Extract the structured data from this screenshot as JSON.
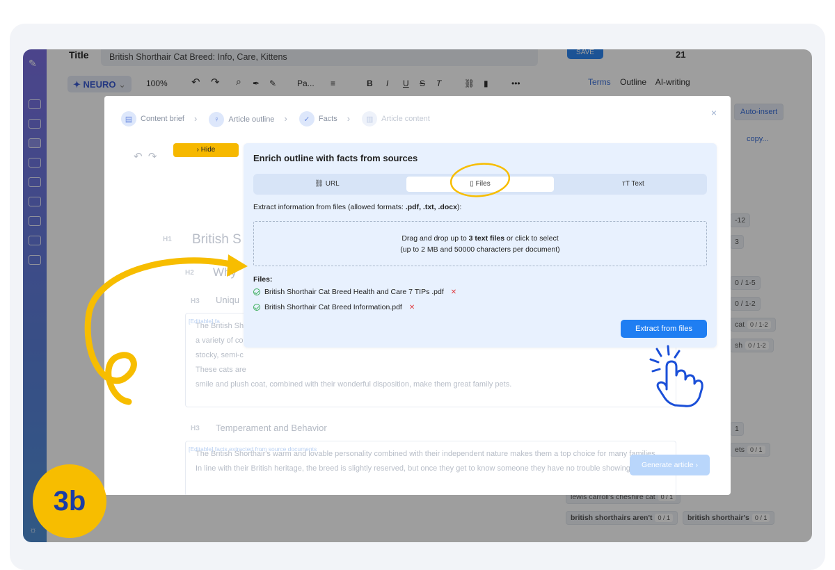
{
  "app": {
    "title_label": "Title",
    "title_value": "British Shorthair Cat Breed: Info, Care, Kittens",
    "save_label": "SAVE",
    "score": "21",
    "neuro_label": "NEURO",
    "zoom": "100%",
    "style_select": "Pa...",
    "right_tabs": [
      "Terms",
      "Outline",
      "AI-writing"
    ],
    "auto_insert": "Auto-insert",
    "copy_label": "copy..."
  },
  "background_chips": [
    {
      "label": "-12"
    },
    {
      "label": "3"
    },
    {
      "label": "0 / 1-5"
    },
    {
      "label": "0 / 1-2"
    },
    {
      "label": "cat",
      "count": "0 / 1-2"
    },
    {
      "label": "sh",
      "count": "0 / 1-2"
    },
    {
      "label": "1"
    },
    {
      "label": "ets",
      "count": "0 / 1"
    },
    {
      "label": "lewis carroll's cheshire cat",
      "count": "0 / 1"
    },
    {
      "label": "british shorthairs aren't",
      "count": "0 / 1"
    },
    {
      "label": "british shorthair's",
      "count": "0 / 1"
    }
  ],
  "modal": {
    "steps": [
      {
        "label": "Content brief"
      },
      {
        "label": "Article outline"
      },
      {
        "label": "Facts"
      },
      {
        "label": "Article content"
      }
    ],
    "hide_label": "› Hide",
    "h1_label": "H1",
    "h1_text": "British S",
    "h2_label": "H2",
    "h2_text": "Why",
    "h3_label": "H3",
    "h3_text_1": "Uniqu",
    "editable_tag": "[Editable] facts extracted from source documents",
    "editable_tag_short": "[Editable] fa",
    "para1": [
      "The British Sh",
      "a variety of co",
      "stocky, semi-c",
      "These cats are",
      "smile and plush coat, combined with their wonderful disposition, make them great family pets."
    ],
    "h3_text_2": "Temperament and Behavior",
    "para2": [
      "The British Shorthair's warm and lovable personality combined with their independent nature makes them a top choice for many families.",
      "In line with their British heritage, the breed is slightly reserved, but once they get to know someone they have no trouble showing"
    ],
    "generate_label": "Generate article ›"
  },
  "panel": {
    "title": "Enrich outline with facts from sources",
    "tabs": [
      {
        "label": "URL",
        "icon": "link-icon"
      },
      {
        "label": "Files",
        "icon": "file-icon"
      },
      {
        "label": "Text",
        "icon": "text-icon"
      }
    ],
    "extract_prefix": "Extract information from files (allowed formats: ",
    "extract_formats": ".pdf, .txt, .docx",
    "extract_suffix": "):",
    "drop_pre": "Drag and drop up to ",
    "drop_bold": "3 text files",
    "drop_post": " or click to select",
    "drop_line2": "(up to 2 MB and 50000 characters per document)",
    "files_label": "Files:",
    "files": [
      {
        "name": "British Shorthair Cat Breed Health and Care 7 TIPs .pdf"
      },
      {
        "name": "British Shorthair Cat Breed Information.pdf"
      }
    ],
    "extract_button": "Extract from files"
  },
  "step_badge": "3b",
  "colors": {
    "accent_yellow": "#f7bd00",
    "badge_text": "#1a3da6",
    "primary_button": "#1f7ef2",
    "panel_bg": "#e8f1fe",
    "hand_icon": "#1a4fd8"
  }
}
